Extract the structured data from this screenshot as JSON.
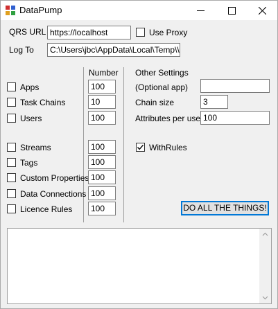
{
  "window": {
    "title": "DataPump"
  },
  "connection": {
    "qrs_url_label": "QRS URL",
    "qrs_url_value": "https://localhost",
    "use_proxy_label": "Use Proxy",
    "use_proxy_checked": false,
    "log_to_label": "Log To",
    "log_to_value": "C:\\Users\\jbc\\AppData\\Local\\Temp\\\\te"
  },
  "counts": {
    "number_header": "Number",
    "items": [
      {
        "label": "Apps",
        "value": "100",
        "checked": false
      },
      {
        "label": "Task Chains",
        "value": "10",
        "checked": false
      },
      {
        "label": "Users",
        "value": "100",
        "checked": false
      },
      {
        "label": "Streams",
        "value": "100",
        "checked": false
      },
      {
        "label": "Tags",
        "value": "100",
        "checked": false
      },
      {
        "label": "Custom Properties",
        "value": "100",
        "checked": false
      },
      {
        "label": "Data Connections",
        "value": "100",
        "checked": false
      },
      {
        "label": "Licence Rules",
        "value": "100",
        "checked": false
      }
    ]
  },
  "other": {
    "header": "Other Settings",
    "optional_app_label": "(Optional app)",
    "optional_app_value": "",
    "chain_size_label": "Chain size",
    "chain_size_value": "3",
    "attributes_label": "Attributes per user",
    "attributes_value": "100",
    "with_rules_label": "WithRules",
    "with_rules_checked": true,
    "do_all_button": "DO ALL THE THINGS!"
  },
  "log_output": {
    "text": ""
  }
}
